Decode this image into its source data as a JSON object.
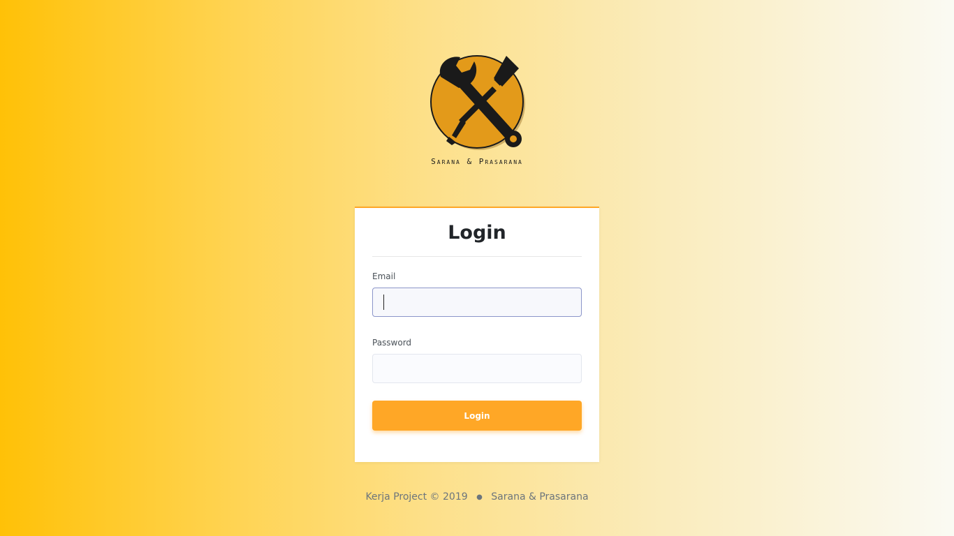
{
  "logo": {
    "caption": "Sarana & Prasarana",
    "icon": "wrench-screwdriver-icon",
    "circle_color": "#e39a1a"
  },
  "login_card": {
    "title": "Login",
    "email_label": "Email",
    "email_value": "",
    "password_label": "Password",
    "password_value": "",
    "submit_label": "Login"
  },
  "footer": {
    "copyright": "Kerja Project © 2019",
    "separator": "●",
    "app_name": "Sarana & Prasarana"
  },
  "colors": {
    "accent": "#ffa726",
    "background_left": "#ffc107",
    "background_right": "#fafaf3"
  }
}
